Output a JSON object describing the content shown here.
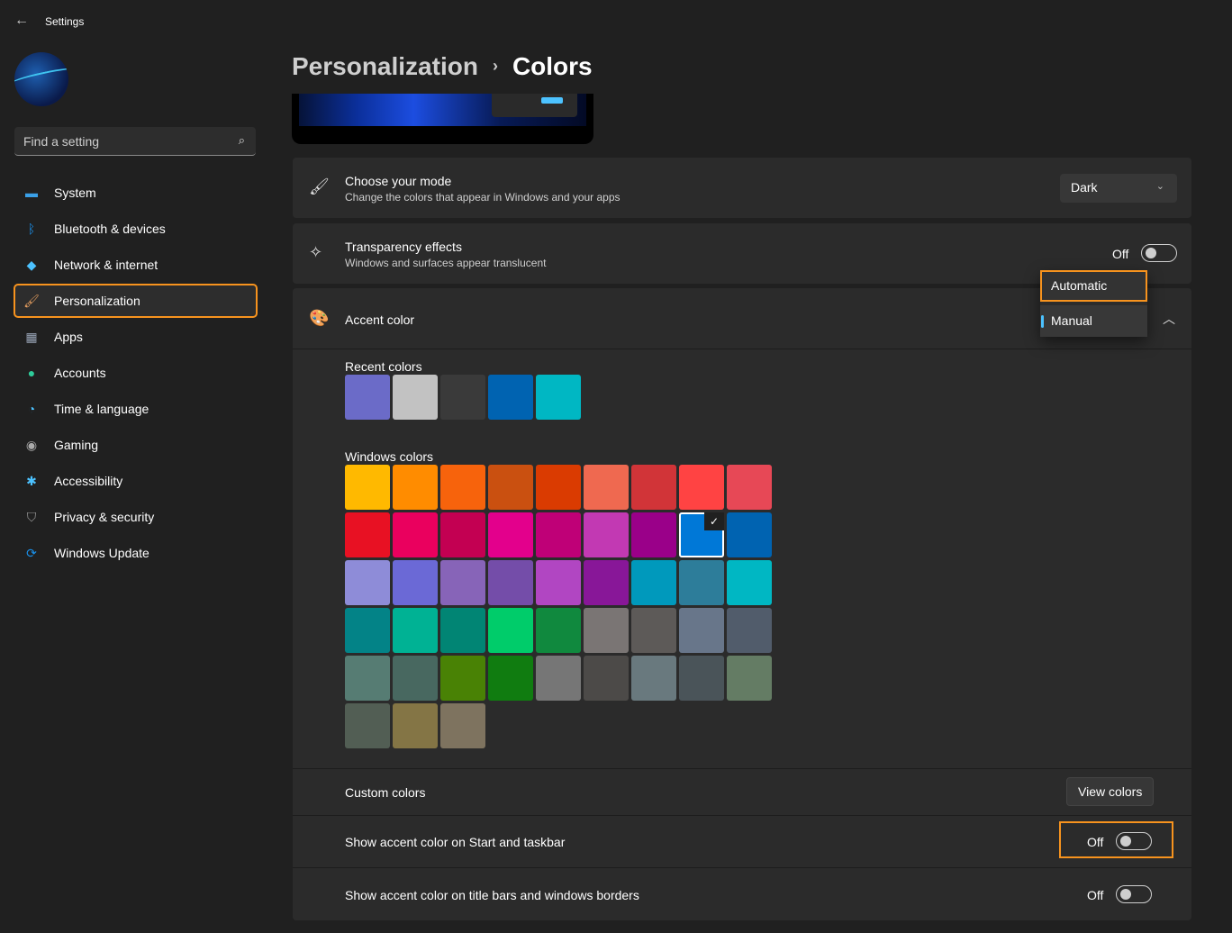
{
  "app": {
    "title": "Settings"
  },
  "search": {
    "placeholder": "Find a setting"
  },
  "sidebar": {
    "items": [
      {
        "label": "System",
        "icon": "system-icon",
        "color": "#3aa0e8"
      },
      {
        "label": "Bluetooth & devices",
        "icon": "bluetooth-icon",
        "color": "#1a8fe8"
      },
      {
        "label": "Network & internet",
        "icon": "wifi-icon",
        "color": "#4cc2ff"
      },
      {
        "label": "Personalization",
        "icon": "brush-icon",
        "color": "#e8a060",
        "active": true
      },
      {
        "label": "Apps",
        "icon": "apps-icon",
        "color": "#9aa6b8"
      },
      {
        "label": "Accounts",
        "icon": "accounts-icon",
        "color": "#2ecc9a"
      },
      {
        "label": "Time & language",
        "icon": "clock-globe-icon",
        "color": "#4cc2ff"
      },
      {
        "label": "Gaming",
        "icon": "gamepad-icon",
        "color": "#aaaaaa"
      },
      {
        "label": "Accessibility",
        "icon": "accessibility-icon",
        "color": "#4cc2ff"
      },
      {
        "label": "Privacy & security",
        "icon": "shield-icon",
        "color": "#9a9a9a"
      },
      {
        "label": "Windows Update",
        "icon": "update-icon",
        "color": "#1a8fe8"
      }
    ]
  },
  "breadcrumb": {
    "parent": "Personalization",
    "separator": "›",
    "current": "Colors"
  },
  "mode": {
    "title": "Choose your mode",
    "subtitle": "Change the colors that appear in Windows and your apps",
    "value": "Dark"
  },
  "transparency": {
    "title": "Transparency effects",
    "subtitle": "Windows and surfaces appear translucent",
    "state": "Off"
  },
  "accent": {
    "title": "Accent color",
    "menu": [
      "Automatic",
      "Manual"
    ],
    "selected": "Manual"
  },
  "recent": {
    "label": "Recent colors",
    "colors": [
      "#6b6bc8",
      "#c2c2c2",
      "#3a3a3a",
      "#0063b1",
      "#00b7c3"
    ]
  },
  "windows_colors": {
    "label": "Windows colors",
    "selected": "#0078d7",
    "colors": [
      "#ffb900",
      "#ff8c00",
      "#f7630c",
      "#ca5010",
      "#da3b01",
      "#ef6950",
      "#d13438",
      "#ff4343",
      "#e74856",
      "#e81123",
      "#ea005e",
      "#c30052",
      "#e3008c",
      "#bf0077",
      "#c239b3",
      "#9a0089",
      "#0078d7",
      "#0063b1",
      "#8e8cd8",
      "#6b69d6",
      "#8764b8",
      "#744da9",
      "#b146c2",
      "#881798",
      "#0099bc",
      "#2d7d9a",
      "#00b7c3",
      "#038387",
      "#00b294",
      "#018574",
      "#00cc6a",
      "#10893e",
      "#7a7574",
      "#5d5a58",
      "#68768a",
      "#515c6b",
      "#567c73",
      "#486860",
      "#498205",
      "#107c10",
      "#767676",
      "#4c4a48",
      "#69797e",
      "#4a5459",
      "#647c64",
      "#525e54",
      "#847545",
      "#7e735f"
    ]
  },
  "custom": {
    "label": "Custom colors",
    "button": "View colors"
  },
  "start_taskbar": {
    "label": "Show accent color on Start and taskbar",
    "state": "Off"
  },
  "title_bars": {
    "label": "Show accent color on title bars and windows borders",
    "state": "Off"
  },
  "highlight_color": "#f7931e"
}
